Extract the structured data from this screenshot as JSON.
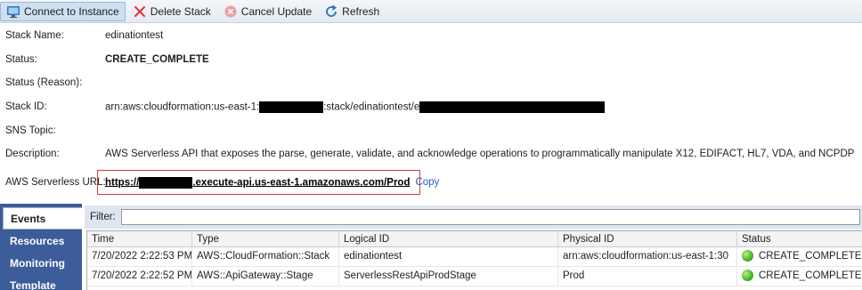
{
  "toolbar": {
    "connect_label": "Connect to Instance",
    "delete_label": "Delete Stack",
    "cancel_label": "Cancel Update",
    "refresh_label": "Refresh"
  },
  "details": {
    "stack_name_label": "Stack Name:",
    "stack_name": "edinationtest",
    "status_label": "Status:",
    "status": "CREATE_COMPLETE",
    "status_reason_label": "Status (Reason):",
    "stack_id_label": "Stack ID:",
    "stack_id_prefix": "arn:aws:cloudformation:us-east-1:",
    "stack_id_mid": ":stack/edinationtest/",
    "stack_id_mid_char": "e",
    "sns_label": "SNS Topic:",
    "description_label": "Description:",
    "description": "AWS Serverless API that exposes the parse, generate, validate, and acknowledge operations to programmatically manipulate X12, EDIFACT, HL7, VDA, and NCPDP",
    "url_label": "AWS Serverless URL:",
    "url_prefix": "https://",
    "url_suffix": ".execute-api.us-east-1.amazonaws.com/Prod",
    "copy_label": "Copy"
  },
  "sidebar": {
    "tabs": [
      {
        "label": "Events"
      },
      {
        "label": "Resources"
      },
      {
        "label": "Monitoring"
      },
      {
        "label": "Template"
      }
    ]
  },
  "filter": {
    "label": "Filter:",
    "value": ""
  },
  "events_table": {
    "columns": [
      "Time",
      "Type",
      "Logical ID",
      "Physical ID",
      "Status"
    ],
    "rows": [
      {
        "time": "7/20/2022 2:22:53 PM",
        "type": "AWS::CloudFormation::Stack",
        "logical_id": "edinationtest",
        "physical_id": "arn:aws:cloudformation:us-east-1:30",
        "status": "CREATE_COMPLETE"
      },
      {
        "time": "7/20/2022 2:22:52 PM",
        "type": "AWS::ApiGateway::Stage",
        "logical_id": "ServerlessRestApiProdStage",
        "physical_id": "Prod",
        "status": "CREATE_COMPLETE"
      }
    ]
  },
  "colors": {
    "status_ok": "#1a8a1a",
    "sidebar_bg": "#3c5d9a",
    "highlight_border": "#d23b3b",
    "link": "#1f5fc4"
  }
}
